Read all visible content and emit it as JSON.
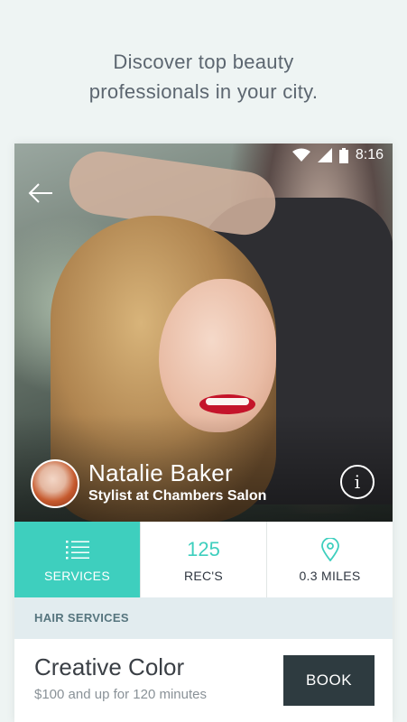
{
  "tagline": {
    "line1": "Discover top beauty",
    "line2": "professionals in your city."
  },
  "status_bar": {
    "time": "8:16",
    "icons": [
      "wifi-icon",
      "cell-signal-icon",
      "battery-icon"
    ]
  },
  "profile": {
    "name": "Natalie Baker",
    "title": "Stylist at Chambers Salon",
    "back_icon": "arrow-left-icon",
    "info_label": "i"
  },
  "stats": [
    {
      "icon": "list-icon",
      "label": "SERVICES",
      "active": true
    },
    {
      "value": "125",
      "label": "REC'S",
      "active": false
    },
    {
      "icon": "map-pin-icon",
      "label": "0.3 MILES",
      "active": false
    }
  ],
  "section": {
    "header": "HAIR SERVICES"
  },
  "service": {
    "name": "Creative Color",
    "detail": "$100 and up for 120 minutes",
    "book_label": "BOOK"
  },
  "colors": {
    "accent": "#3ecfbe",
    "book_button": "#2e3b40",
    "section_bg": "#e2ecef",
    "page_bg": "#eef4f3"
  }
}
